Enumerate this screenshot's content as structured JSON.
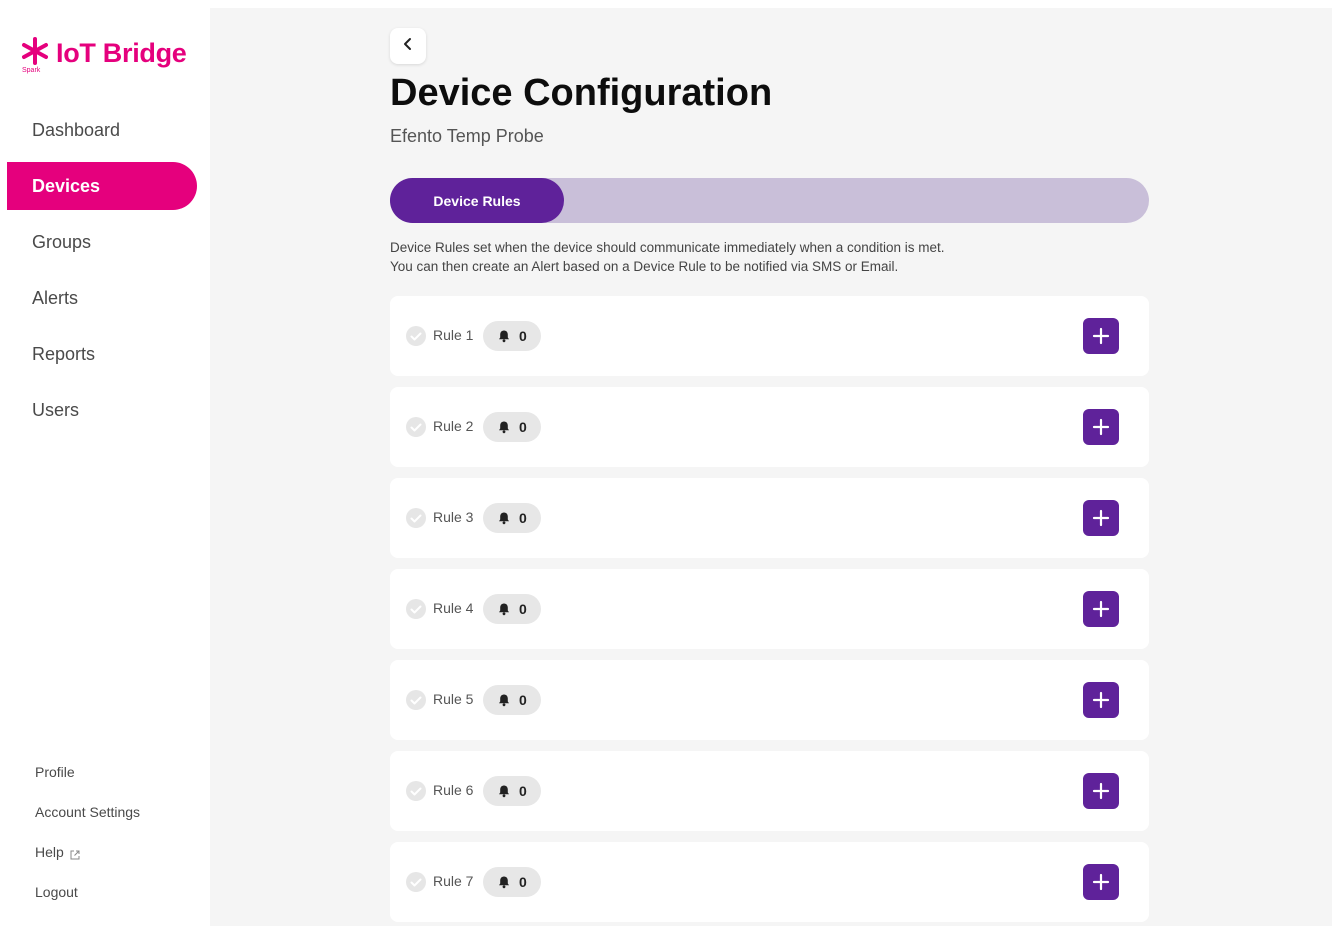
{
  "brand": {
    "name": "IoT Bridge",
    "sub": "Spark",
    "color": "#e5007d"
  },
  "sidebar": {
    "items": [
      {
        "label": "Dashboard",
        "active": false
      },
      {
        "label": "Devices",
        "active": true
      },
      {
        "label": "Groups",
        "active": false
      },
      {
        "label": "Alerts",
        "active": false
      },
      {
        "label": "Reports",
        "active": false
      },
      {
        "label": "Users",
        "active": false
      }
    ],
    "bottom": [
      {
        "label": "Profile"
      },
      {
        "label": "Account Settings"
      },
      {
        "label": "Help",
        "icon": "external-link-icon"
      },
      {
        "label": "Logout"
      }
    ]
  },
  "header": {
    "title": "Device Configuration",
    "subtitle": "Efento Temp Probe"
  },
  "tabs": [
    {
      "label": "Device Rules",
      "active": true
    }
  ],
  "description": {
    "line1": "Device Rules set when the device should communicate immediately when a condition is met.",
    "line2": "You can then create an Alert based on a Device Rule to be notified via SMS or Email."
  },
  "rules": [
    {
      "label": "Rule 1",
      "alerts": "0"
    },
    {
      "label": "Rule 2",
      "alerts": "0"
    },
    {
      "label": "Rule 3",
      "alerts": "0"
    },
    {
      "label": "Rule 4",
      "alerts": "0"
    },
    {
      "label": "Rule 5",
      "alerts": "0"
    },
    {
      "label": "Rule 6",
      "alerts": "0"
    },
    {
      "label": "Rule 7",
      "alerts": "0"
    }
  ],
  "colors": {
    "accent": "#5f229a",
    "brand": "#e5007d",
    "tab_track": "#c9bfd9"
  }
}
